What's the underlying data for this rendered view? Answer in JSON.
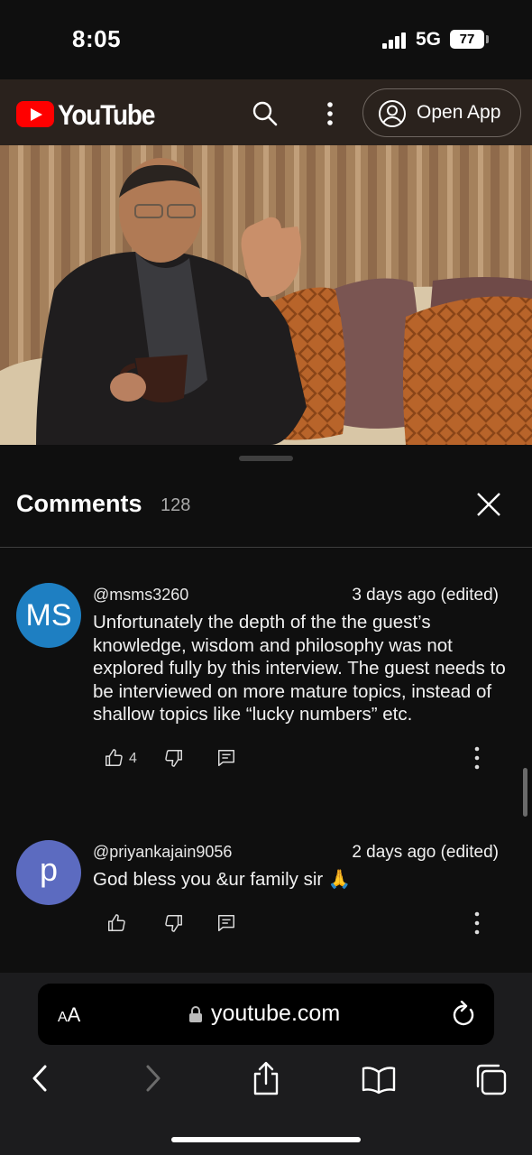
{
  "status": {
    "time": "8:05",
    "network": "5G",
    "battery": "77"
  },
  "header": {
    "brand": "YouTube",
    "open_app_label": "Open App",
    "icons": {
      "search": "search-icon",
      "more": "more-vert-icon",
      "account": "account-circle-icon"
    }
  },
  "video": {
    "description_icon": "video-thumbnail"
  },
  "comments": {
    "title": "Comments",
    "count": "128",
    "items": [
      {
        "avatar_text": "MS",
        "avatar_color": "#1e7fc2",
        "handle": "@msms3260",
        "time": "3 days ago (edited)",
        "text": "Unfortunately the depth of the the guest’s knowledge, wisdom and philosophy was not explored fully by this interview. The guest needs to be interviewed on more mature topics, instead of shallow topics like “lucky numbers” etc.",
        "likes": "4"
      },
      {
        "avatar_text": "p",
        "avatar_color": "#5c6bc0",
        "handle": "@priyankajain9056",
        "time": "2 days ago (edited)",
        "text": "God bless you &ur family sir 🙏",
        "likes": ""
      }
    ]
  },
  "browser": {
    "text_size_label_big": "A",
    "text_size_label_small": "A",
    "url": "youtube.com"
  },
  "colors": {
    "brand_red": "#ff0000",
    "header_bg": "#2a221d",
    "panel_bg": "#0f0f0f"
  }
}
